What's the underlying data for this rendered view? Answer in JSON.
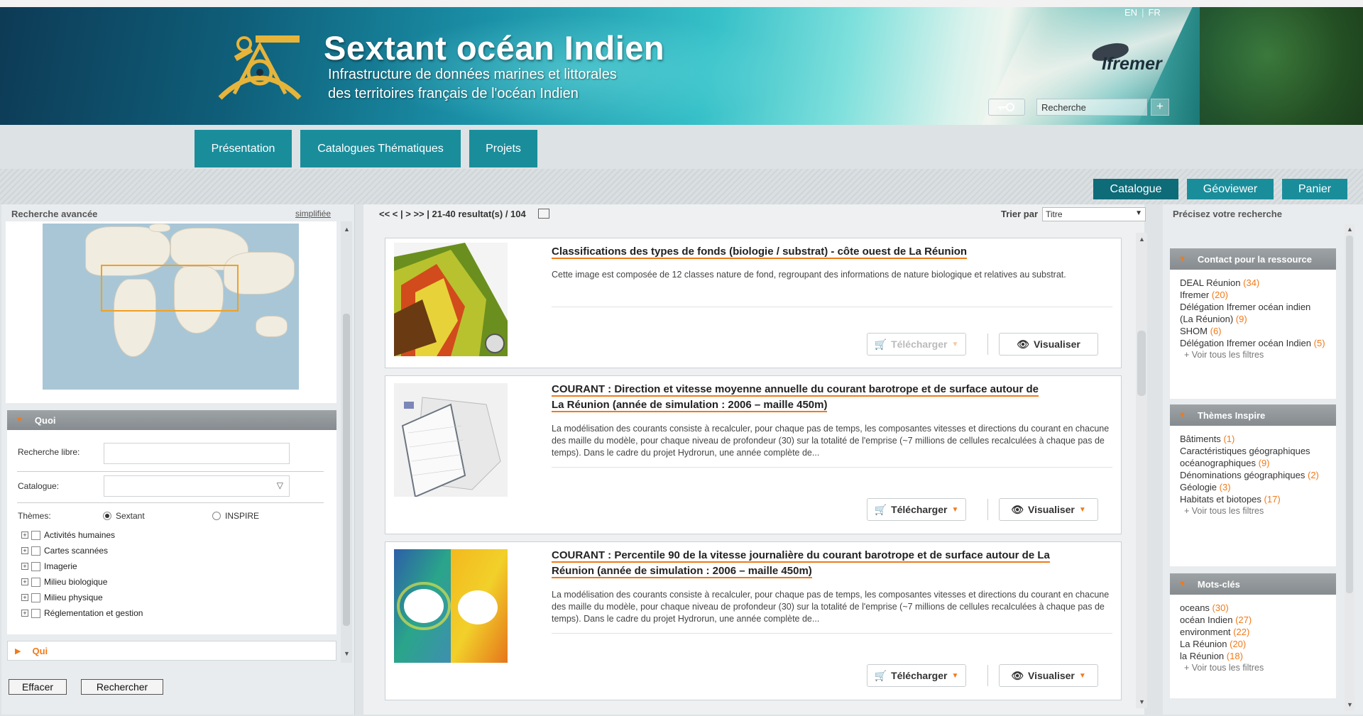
{
  "header": {
    "title": "Sextant océan Indien",
    "subtitle_line1": "Infrastructure de données marines et littorales",
    "subtitle_line2": "des territoires français de l'océan Indien",
    "lang_en": "EN",
    "lang_fr": "FR",
    "partner": "Ifremer",
    "search_placeholder": "Recherche",
    "search_plus": "+"
  },
  "nav": {
    "tabs": [
      {
        "label": "Présentation"
      },
      {
        "label": "Catalogues Thématiques"
      },
      {
        "label": "Projets"
      }
    ],
    "subtabs": [
      {
        "label": "Catalogue"
      },
      {
        "label": "Géoviewer"
      },
      {
        "label": "Panier"
      }
    ]
  },
  "left": {
    "title": "Recherche avancée",
    "simplified_link": "simplifiée",
    "quoi": "Quoi",
    "recherche_libre": "Recherche libre:",
    "catalogue": "Catalogue:",
    "themes": "Thèmes:",
    "radio_sextant": "Sextant",
    "radio_inspire": "INSPIRE",
    "theme_items": [
      {
        "label": "Activités humaines"
      },
      {
        "label": "Cartes scannées"
      },
      {
        "label": "Imagerie"
      },
      {
        "label": "Milieu biologique"
      },
      {
        "label": "Milieu physique"
      },
      {
        "label": "Réglementation et gestion"
      }
    ],
    "qui": "Qui",
    "btn_effacer": "Effacer",
    "btn_rechercher": "Rechercher"
  },
  "center": {
    "pager": "<< < | > >> | 21-40 resultat(s) / 104",
    "sort_label": "Trier par",
    "sort_value": "Titre",
    "results": [
      {
        "title": "Classifications des types de fonds (biologie / substrat) - côte ouest de La Réunion",
        "desc": "Cette image est composée de 12 classes nature de fond, regroupant des informations de nature biologique et relatives au substrat.",
        "download": "Télécharger",
        "view": "Visualiser"
      },
      {
        "title_line1": "COURANT : Direction et vitesse moyenne annuelle du courant barotrope et de surface autour de",
        "title_line2": "La Réunion (année de simulation : 2006 – maille 450m)",
        "desc": "La modélisation des courants consiste à recalculer, pour chaque pas de temps, les composantes vitesses et directions du courant en chacune des maille du modèle, pour chaque niveau de profondeur (30) sur la totalité de l'emprise (~7 millions de cellules recalculées à chaque pas de temps). Dans le cadre du projet Hydrorun, une année complète de...",
        "download": "Télécharger",
        "view": "Visualiser"
      },
      {
        "title_line1": "COURANT : Percentile 90 de la vitesse journalière du courant barotrope et de surface autour de La",
        "title_line2": "Réunion (année de simulation : 2006 – maille 450m)",
        "desc": "La modélisation des courants consiste à recalculer, pour chaque pas de temps, les composantes vitesses et directions du courant en chacune des maille du modèle, pour chaque niveau de profondeur (30) sur la totalité de l'emprise (~7 millions de cellules recalculées à chaque pas de temps). Dans le cadre du projet Hydrorun, une année complète de...",
        "download": "Télécharger",
        "view": "Visualiser"
      }
    ]
  },
  "right": {
    "title": "Précisez votre recherche",
    "facets": [
      {
        "title": "Contact pour la ressource",
        "items": [
          {
            "label": "DEAL Réunion",
            "count": "(34)"
          },
          {
            "label": "Ifremer",
            "count": "(20)"
          },
          {
            "label": "Délégation Ifremer océan indien (La Réunion)",
            "count": "(9)"
          },
          {
            "label": "SHOM",
            "count": "(6)"
          },
          {
            "label": "Délégation Ifremer océan Indien",
            "count": "(5)"
          }
        ],
        "more": "+ Voir tous les filtres"
      },
      {
        "title": "Thèmes Inspire",
        "items": [
          {
            "label": "Bâtiments",
            "count": "(1)"
          },
          {
            "label": "Caractéristiques géographiques océanographiques",
            "count": "(9)"
          },
          {
            "label": "Dénominations géographiques",
            "count": "(2)"
          },
          {
            "label": "Géologie",
            "count": "(3)"
          },
          {
            "label": "Habitats et biotopes",
            "count": "(17)"
          }
        ],
        "more": "+ Voir tous les filtres"
      },
      {
        "title": "Mots-clés",
        "items": [
          {
            "label": "oceans",
            "count": "(30)"
          },
          {
            "label": "océan Indien",
            "count": "(27)"
          },
          {
            "label": "environment",
            "count": "(22)"
          },
          {
            "label": "La Réunion",
            "count": "(20)"
          },
          {
            "label": "la Réunion",
            "count": "(18)"
          }
        ],
        "more": "+ Voir tous les filtres"
      }
    ]
  },
  "colors": {
    "accent": "#1a8d9b",
    "dark_tab": "#0e6b78",
    "orange": "#f07a1a"
  }
}
